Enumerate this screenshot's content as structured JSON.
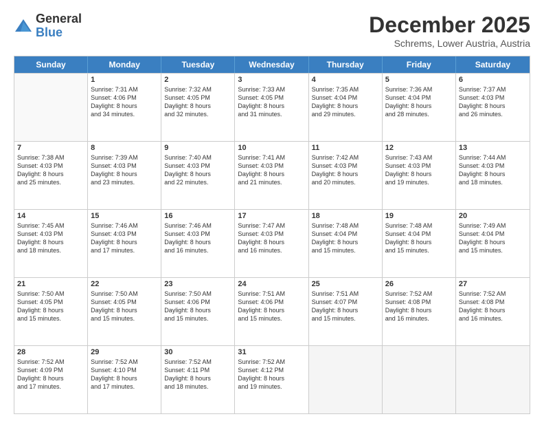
{
  "logo": {
    "general": "General",
    "blue": "Blue"
  },
  "title": "December 2025",
  "subtitle": "Schrems, Lower Austria, Austria",
  "header_days": [
    "Sunday",
    "Monday",
    "Tuesday",
    "Wednesday",
    "Thursday",
    "Friday",
    "Saturday"
  ],
  "rows": [
    [
      {
        "day": "",
        "lines": []
      },
      {
        "day": "1",
        "lines": [
          "Sunrise: 7:31 AM",
          "Sunset: 4:06 PM",
          "Daylight: 8 hours",
          "and 34 minutes."
        ]
      },
      {
        "day": "2",
        "lines": [
          "Sunrise: 7:32 AM",
          "Sunset: 4:05 PM",
          "Daylight: 8 hours",
          "and 32 minutes."
        ]
      },
      {
        "day": "3",
        "lines": [
          "Sunrise: 7:33 AM",
          "Sunset: 4:05 PM",
          "Daylight: 8 hours",
          "and 31 minutes."
        ]
      },
      {
        "day": "4",
        "lines": [
          "Sunrise: 7:35 AM",
          "Sunset: 4:04 PM",
          "Daylight: 8 hours",
          "and 29 minutes."
        ]
      },
      {
        "day": "5",
        "lines": [
          "Sunrise: 7:36 AM",
          "Sunset: 4:04 PM",
          "Daylight: 8 hours",
          "and 28 minutes."
        ]
      },
      {
        "day": "6",
        "lines": [
          "Sunrise: 7:37 AM",
          "Sunset: 4:03 PM",
          "Daylight: 8 hours",
          "and 26 minutes."
        ]
      }
    ],
    [
      {
        "day": "7",
        "lines": [
          "Sunrise: 7:38 AM",
          "Sunset: 4:03 PM",
          "Daylight: 8 hours",
          "and 25 minutes."
        ]
      },
      {
        "day": "8",
        "lines": [
          "Sunrise: 7:39 AM",
          "Sunset: 4:03 PM",
          "Daylight: 8 hours",
          "and 23 minutes."
        ]
      },
      {
        "day": "9",
        "lines": [
          "Sunrise: 7:40 AM",
          "Sunset: 4:03 PM",
          "Daylight: 8 hours",
          "and 22 minutes."
        ]
      },
      {
        "day": "10",
        "lines": [
          "Sunrise: 7:41 AM",
          "Sunset: 4:03 PM",
          "Daylight: 8 hours",
          "and 21 minutes."
        ]
      },
      {
        "day": "11",
        "lines": [
          "Sunrise: 7:42 AM",
          "Sunset: 4:03 PM",
          "Daylight: 8 hours",
          "and 20 minutes."
        ]
      },
      {
        "day": "12",
        "lines": [
          "Sunrise: 7:43 AM",
          "Sunset: 4:03 PM",
          "Daylight: 8 hours",
          "and 19 minutes."
        ]
      },
      {
        "day": "13",
        "lines": [
          "Sunrise: 7:44 AM",
          "Sunset: 4:03 PM",
          "Daylight: 8 hours",
          "and 18 minutes."
        ]
      }
    ],
    [
      {
        "day": "14",
        "lines": [
          "Sunrise: 7:45 AM",
          "Sunset: 4:03 PM",
          "Daylight: 8 hours",
          "and 18 minutes."
        ]
      },
      {
        "day": "15",
        "lines": [
          "Sunrise: 7:46 AM",
          "Sunset: 4:03 PM",
          "Daylight: 8 hours",
          "and 17 minutes."
        ]
      },
      {
        "day": "16",
        "lines": [
          "Sunrise: 7:46 AM",
          "Sunset: 4:03 PM",
          "Daylight: 8 hours",
          "and 16 minutes."
        ]
      },
      {
        "day": "17",
        "lines": [
          "Sunrise: 7:47 AM",
          "Sunset: 4:03 PM",
          "Daylight: 8 hours",
          "and 16 minutes."
        ]
      },
      {
        "day": "18",
        "lines": [
          "Sunrise: 7:48 AM",
          "Sunset: 4:04 PM",
          "Daylight: 8 hours",
          "and 15 minutes."
        ]
      },
      {
        "day": "19",
        "lines": [
          "Sunrise: 7:48 AM",
          "Sunset: 4:04 PM",
          "Daylight: 8 hours",
          "and 15 minutes."
        ]
      },
      {
        "day": "20",
        "lines": [
          "Sunrise: 7:49 AM",
          "Sunset: 4:04 PM",
          "Daylight: 8 hours",
          "and 15 minutes."
        ]
      }
    ],
    [
      {
        "day": "21",
        "lines": [
          "Sunrise: 7:50 AM",
          "Sunset: 4:05 PM",
          "Daylight: 8 hours",
          "and 15 minutes."
        ]
      },
      {
        "day": "22",
        "lines": [
          "Sunrise: 7:50 AM",
          "Sunset: 4:05 PM",
          "Daylight: 8 hours",
          "and 15 minutes."
        ]
      },
      {
        "day": "23",
        "lines": [
          "Sunrise: 7:50 AM",
          "Sunset: 4:06 PM",
          "Daylight: 8 hours",
          "and 15 minutes."
        ]
      },
      {
        "day": "24",
        "lines": [
          "Sunrise: 7:51 AM",
          "Sunset: 4:06 PM",
          "Daylight: 8 hours",
          "and 15 minutes."
        ]
      },
      {
        "day": "25",
        "lines": [
          "Sunrise: 7:51 AM",
          "Sunset: 4:07 PM",
          "Daylight: 8 hours",
          "and 15 minutes."
        ]
      },
      {
        "day": "26",
        "lines": [
          "Sunrise: 7:52 AM",
          "Sunset: 4:08 PM",
          "Daylight: 8 hours",
          "and 16 minutes."
        ]
      },
      {
        "day": "27",
        "lines": [
          "Sunrise: 7:52 AM",
          "Sunset: 4:08 PM",
          "Daylight: 8 hours",
          "and 16 minutes."
        ]
      }
    ],
    [
      {
        "day": "28",
        "lines": [
          "Sunrise: 7:52 AM",
          "Sunset: 4:09 PM",
          "Daylight: 8 hours",
          "and 17 minutes."
        ]
      },
      {
        "day": "29",
        "lines": [
          "Sunrise: 7:52 AM",
          "Sunset: 4:10 PM",
          "Daylight: 8 hours",
          "and 17 minutes."
        ]
      },
      {
        "day": "30",
        "lines": [
          "Sunrise: 7:52 AM",
          "Sunset: 4:11 PM",
          "Daylight: 8 hours",
          "and 18 minutes."
        ]
      },
      {
        "day": "31",
        "lines": [
          "Sunrise: 7:52 AM",
          "Sunset: 4:12 PM",
          "Daylight: 8 hours",
          "and 19 minutes."
        ]
      },
      {
        "day": "",
        "lines": []
      },
      {
        "day": "",
        "lines": []
      },
      {
        "day": "",
        "lines": []
      }
    ]
  ]
}
